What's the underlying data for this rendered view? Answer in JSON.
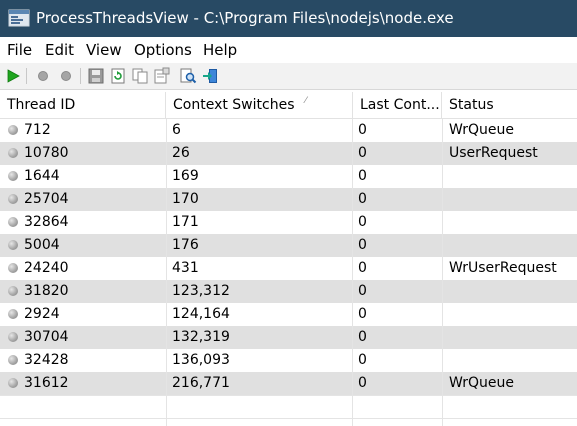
{
  "window": {
    "title": "ProcessThreadsView -  C:\\Program Files\\nodejs\\node.exe"
  },
  "menu": [
    "File",
    "Edit",
    "View",
    "Options",
    "Help"
  ],
  "toolbar": {
    "icons": [
      "play-icon",
      "dot-icon",
      "dot-icon",
      "save-icon",
      "refresh-icon",
      "copy-icon",
      "properties-icon",
      "search-icon",
      "exit-icon"
    ]
  },
  "columns": [
    "Thread ID",
    "Context Switches",
    "Last Cont...",
    "Status"
  ],
  "rows": [
    {
      "thread_id": "712",
      "context_switches": "6",
      "last_context": "0",
      "status": "WrQueue"
    },
    {
      "thread_id": "10780",
      "context_switches": "26",
      "last_context": "0",
      "status": "UserRequest"
    },
    {
      "thread_id": "1644",
      "context_switches": "169",
      "last_context": "0",
      "status": ""
    },
    {
      "thread_id": "25704",
      "context_switches": "170",
      "last_context": "0",
      "status": ""
    },
    {
      "thread_id": "32864",
      "context_switches": "171",
      "last_context": "0",
      "status": ""
    },
    {
      "thread_id": "5004",
      "context_switches": "176",
      "last_context": "0",
      "status": ""
    },
    {
      "thread_id": "24240",
      "context_switches": "431",
      "last_context": "0",
      "status": "WrUserRequest"
    },
    {
      "thread_id": "31820",
      "context_switches": "123,312",
      "last_context": "0",
      "status": ""
    },
    {
      "thread_id": "2924",
      "context_switches": "124,164",
      "last_context": "0",
      "status": ""
    },
    {
      "thread_id": "30704",
      "context_switches": "132,319",
      "last_context": "0",
      "status": ""
    },
    {
      "thread_id": "32428",
      "context_switches": "136,093",
      "last_context": "0",
      "status": ""
    },
    {
      "thread_id": "31612",
      "context_switches": "216,771",
      "last_context": "0",
      "status": "WrQueue"
    }
  ]
}
